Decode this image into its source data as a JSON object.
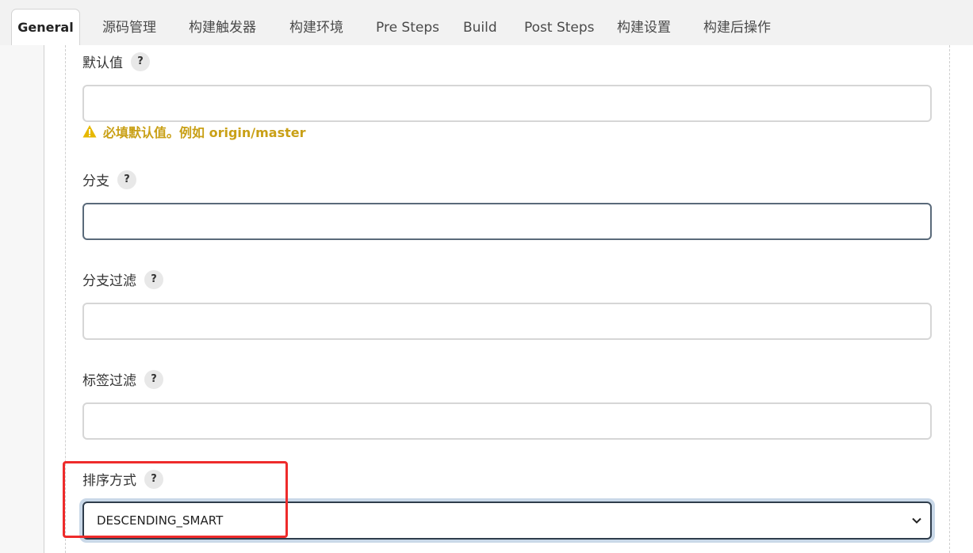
{
  "tabs": [
    {
      "label": "General",
      "active": true
    },
    {
      "label": "源码管理"
    },
    {
      "label": "构建触发器"
    },
    {
      "label": "构建环境"
    },
    {
      "label": "Pre Steps"
    },
    {
      "label": "Build"
    },
    {
      "label": "Post Steps"
    },
    {
      "label": "构建设置"
    },
    {
      "label": "构建后操作"
    }
  ],
  "fields": {
    "default_value": {
      "label": "默认值",
      "value": ""
    },
    "default_warning": "必填默认值。例如 origin/master",
    "branch": {
      "label": "分支",
      "value": ""
    },
    "branch_filter": {
      "label": "分支过滤",
      "value": ""
    },
    "tag_filter": {
      "label": "标签过滤",
      "value": ""
    },
    "sort_mode": {
      "label": "排序方式",
      "selected": "DESCENDING_SMART"
    }
  },
  "help_glyph": "?",
  "colors": {
    "warning": "#c9a016",
    "highlight": "#ee2b2b",
    "focus_border": "#2f3d4c"
  }
}
